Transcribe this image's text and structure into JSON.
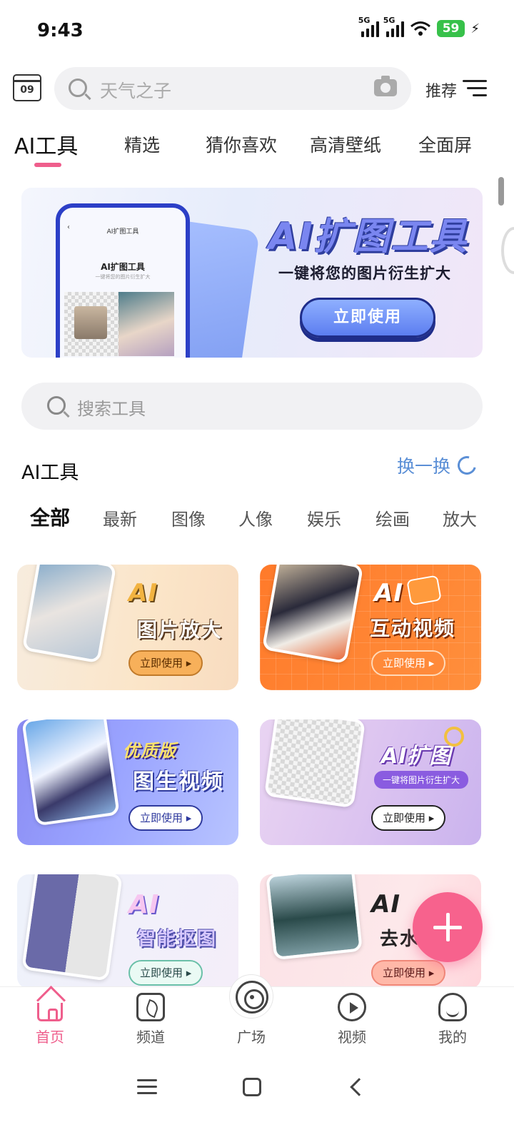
{
  "status_bar": {
    "time": "9:43",
    "sim1": "5G",
    "sim2": "5G",
    "battery": "59"
  },
  "header": {
    "calendar_day": "09",
    "search_placeholder": "天气之子",
    "recommend_label": "推荐"
  },
  "category_tabs": [
    {
      "label": "AI工具",
      "active": true
    },
    {
      "label": "精选"
    },
    {
      "label": "猜你喜欢"
    },
    {
      "label": "高清壁纸"
    },
    {
      "label": "全面屏"
    }
  ],
  "banner": {
    "title": "AI扩图工具",
    "subtitle": "一键将您的图片衍生扩大",
    "button": "立即使用",
    "phone_topbar": "AI扩图工具",
    "phone_heading": "AI扩图工具",
    "phone_subtitle": "一键将您的图片衍生扩大"
  },
  "tool_search": {
    "placeholder": "搜索工具"
  },
  "section": {
    "title": "AI工具",
    "refresh": "换一换"
  },
  "sub_tabs": [
    {
      "label": "全部",
      "active": true
    },
    {
      "label": "最新"
    },
    {
      "label": "图像"
    },
    {
      "label": "人像"
    },
    {
      "label": "娱乐"
    },
    {
      "label": "绘画"
    },
    {
      "label": "放大"
    }
  ],
  "cards": [
    {
      "line1": "AI",
      "line2": "图片放大",
      "button": "立即使用 ▸"
    },
    {
      "line1": "AI",
      "line2": "互动视频",
      "button": "立即使用 ▸"
    },
    {
      "line1": "优质版",
      "line2": "图生视频",
      "button": "立即使用 ▸"
    },
    {
      "line1": "AI扩图",
      "line2": "一键将图片衍生扩大",
      "button": "立即使用 ▸"
    },
    {
      "line1": "AI",
      "line2": "智能抠图",
      "button": "立即使用 ▸"
    },
    {
      "line1": "AI",
      "line2": "去水",
      "button": "立即使用 ▸"
    }
  ],
  "bottom_nav": [
    {
      "label": "首页",
      "icon": "home-icon",
      "active": true
    },
    {
      "label": "频道",
      "icon": "channel-icon"
    },
    {
      "label": "广场",
      "icon": "broadcast-icon"
    },
    {
      "label": "视频",
      "icon": "play-icon"
    },
    {
      "label": "我的",
      "icon": "profile-icon"
    }
  ],
  "colors": {
    "accent": "#ef5e8c",
    "link": "#5b8fd6",
    "fab": "#f7628d"
  }
}
